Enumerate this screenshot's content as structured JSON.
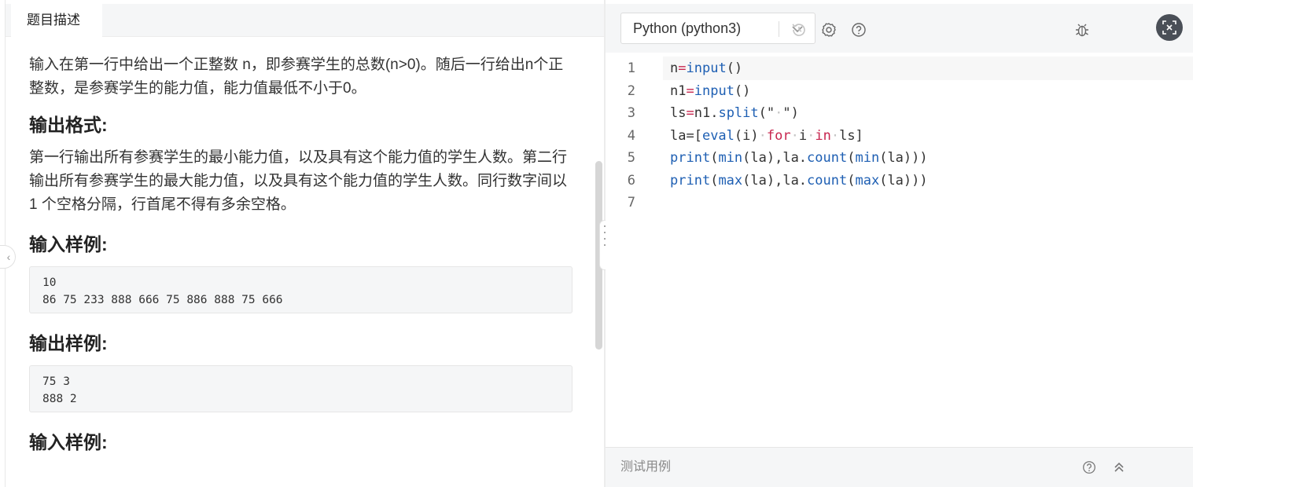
{
  "left": {
    "tab": "题目描述",
    "intro": "输入在第一行中给出一个正整数 n，即参赛学生的总数(n>0)。随后一行给出n个正整数，是参赛学生的能力值，能力值最低不小于0。",
    "sections": [
      {
        "heading": "输出格式:",
        "text": "第一行输出所有参赛学生的最小能力值，以及具有这个能力值的学生人数。第二行输出所有参赛学生的最大能力值，以及具有这个能力值的学生人数。同行数字间以 1 个空格分隔，行首尾不得有多余空格。"
      },
      {
        "heading": "输入样例:",
        "code": "10\n86 75 233 888 666 75 886 888 75 666"
      },
      {
        "heading": "输出样例:",
        "code": "75 3\n888 2"
      },
      {
        "heading": "输入样例:"
      }
    ]
  },
  "right": {
    "language": "Python (python3)",
    "icons": [
      "history-icon",
      "settings-icon",
      "help-icon",
      "debug-icon",
      "fullscreen-icon"
    ],
    "code_lines": [
      {
        "num": "1",
        "text": "n=input()"
      },
      {
        "num": "2",
        "text": "n1=input()"
      },
      {
        "num": "3",
        "text": "ls=n1.split(\" \")"
      },
      {
        "num": "4",
        "text": "la=[eval(i) for i in ls]"
      },
      {
        "num": "5",
        "text": "print(min(la),la.count(min(la)))"
      },
      {
        "num": "6",
        "text": "print(max(la),la.count(max(la)))"
      },
      {
        "num": "7",
        "text": ""
      }
    ],
    "test_label": "测试用例"
  },
  "colors": {
    "keyword": "#1e5fb3",
    "keyword_red": "#c7254e",
    "panel_bg": "#f5f6f7"
  }
}
